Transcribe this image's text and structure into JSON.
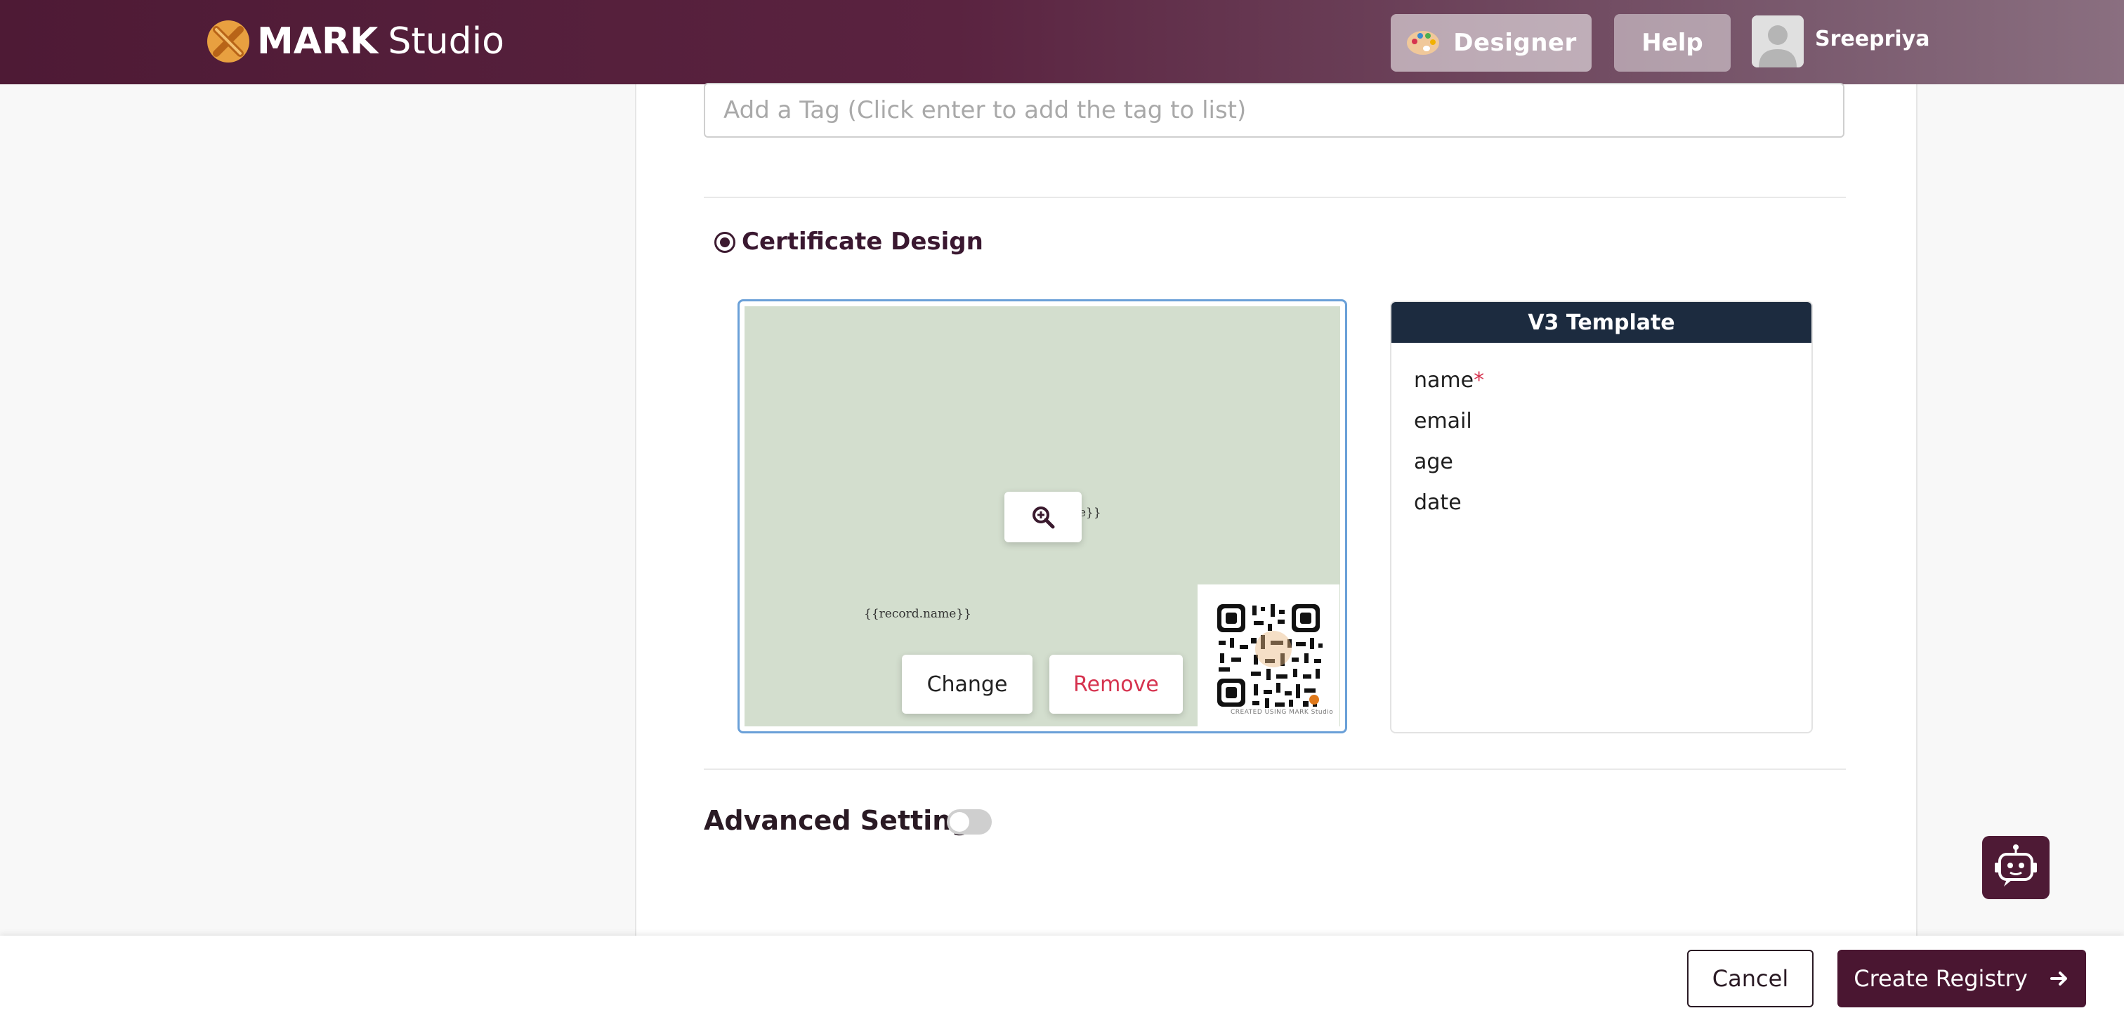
{
  "header": {
    "brand_bold": "MARK",
    "brand_light": "Studio",
    "designer_label": "Designer",
    "help_label": "Help",
    "username": "Sreepriya"
  },
  "form": {
    "tag_placeholder": "Add a Tag (Click enter to add the tag to list)",
    "certificate_design_label": "Certificate Design",
    "advanced_settings_label": "Advanced Settings",
    "advanced_settings_enabled": false
  },
  "certificate_preview": {
    "placeholder_text_1": "e}}",
    "placeholder_text_2": "{{record.name}}",
    "change_label": "Change",
    "remove_label": "Remove",
    "qr_caption": "CREATED USING  MARK Studio"
  },
  "template": {
    "title": "V3 Template",
    "fields": [
      {
        "name": "name",
        "required": "*"
      },
      {
        "name": "email"
      },
      {
        "name": "age"
      },
      {
        "name": "date"
      }
    ]
  },
  "footer": {
    "cancel_label": "Cancel",
    "create_label": "Create Registry"
  },
  "colors": {
    "brand": "#4e1a35",
    "accent_blue": "#6aa0d8",
    "danger": "#d6334f",
    "template_header": "#1c2b3f"
  },
  "icons": {
    "logo": "mark-studio-logo-icon",
    "designer": "palette-icon",
    "zoom": "zoom-in-icon",
    "chatbot": "robot-icon",
    "create_arrow": "arrow-right-icon"
  }
}
